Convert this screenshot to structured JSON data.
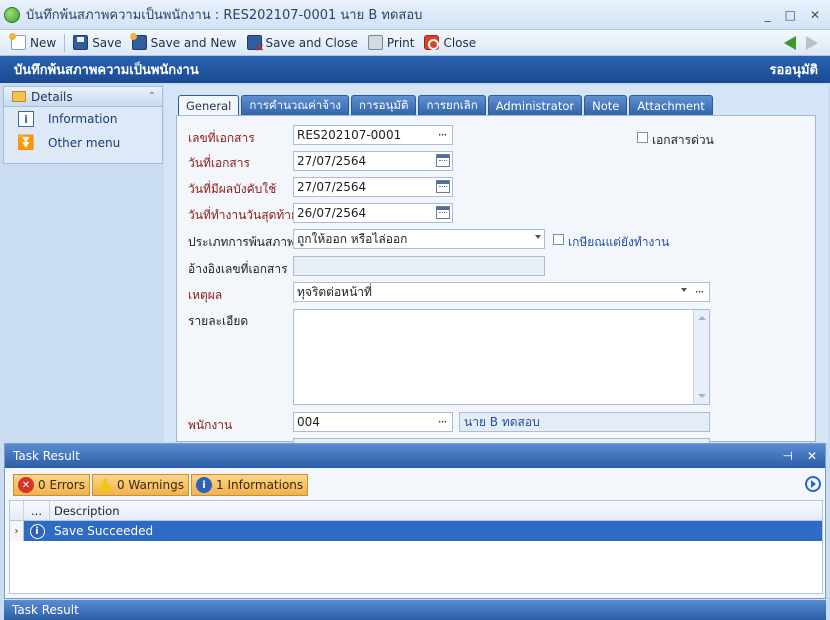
{
  "window": {
    "title": "บันทึกพ้นสภาพความเป็นพนักงาน : RES202107-0001 นาย B ทดสอบ",
    "controls": [
      "_",
      "□",
      "✕"
    ]
  },
  "toolbar": {
    "new_label": "New",
    "save_label": "Save",
    "save_new_label": "Save and New",
    "save_close_label": "Save and Close",
    "print_label": "Print",
    "close_label": "Close"
  },
  "header": {
    "title": "บันทึกพ้นสภาพความเป็นพนักงาน",
    "status": "รออนุมัติ"
  },
  "sidebar": {
    "title": "Details",
    "items": [
      {
        "label": "Information"
      },
      {
        "label": "Other menu"
      }
    ]
  },
  "tabs": [
    {
      "label": "General"
    },
    {
      "label": "การคำนวณค่าจ้าง"
    },
    {
      "label": "การอนุมัติ"
    },
    {
      "label": "การยกเลิก"
    },
    {
      "label": "Administrator"
    },
    {
      "label": "Note"
    },
    {
      "label": "Attachment"
    }
  ],
  "form": {
    "doc_no_label": "เลขที่เอกสาร",
    "doc_no": "RES202107-0001",
    "urgent_label": "เอกสารด่วน",
    "doc_date_label": "วันที่เอกสาร",
    "doc_date": "27/07/2564",
    "effective_label": "วันที่มีผลบังคับใช้",
    "effective_date": "27/07/2564",
    "last_work_label": "วันที่ทำงานวันสุดท้าย",
    "last_work_date": "26/07/2564",
    "type_label": "ประเภทการพ้นสภาพ",
    "type_value": "ถูกให้ออก หรือไล่ออก",
    "retire_label": "เกษียณแต่ยังทำงาน",
    "ref_label": "อ้างอิงเลขที่เอกสาร",
    "ref_value": "",
    "reason_label": "เหตุผล",
    "reason_value": "ทุจริตต่อหน้าที่",
    "detail_label": "รายละเอียด",
    "detail_value": "",
    "employee_label": "พนักงาน",
    "employee_code": "004",
    "employee_name": "นาย B ทดสอบ"
  },
  "task_result": {
    "title": "Task Result",
    "errors_label": "0 Errors",
    "warnings_label": "0 Warnings",
    "info_label": "1 Informations",
    "columns": [
      "...",
      "Description"
    ],
    "rows": [
      {
        "description": "Save Succeeded"
      }
    ],
    "footer_tab": "Task Result"
  }
}
